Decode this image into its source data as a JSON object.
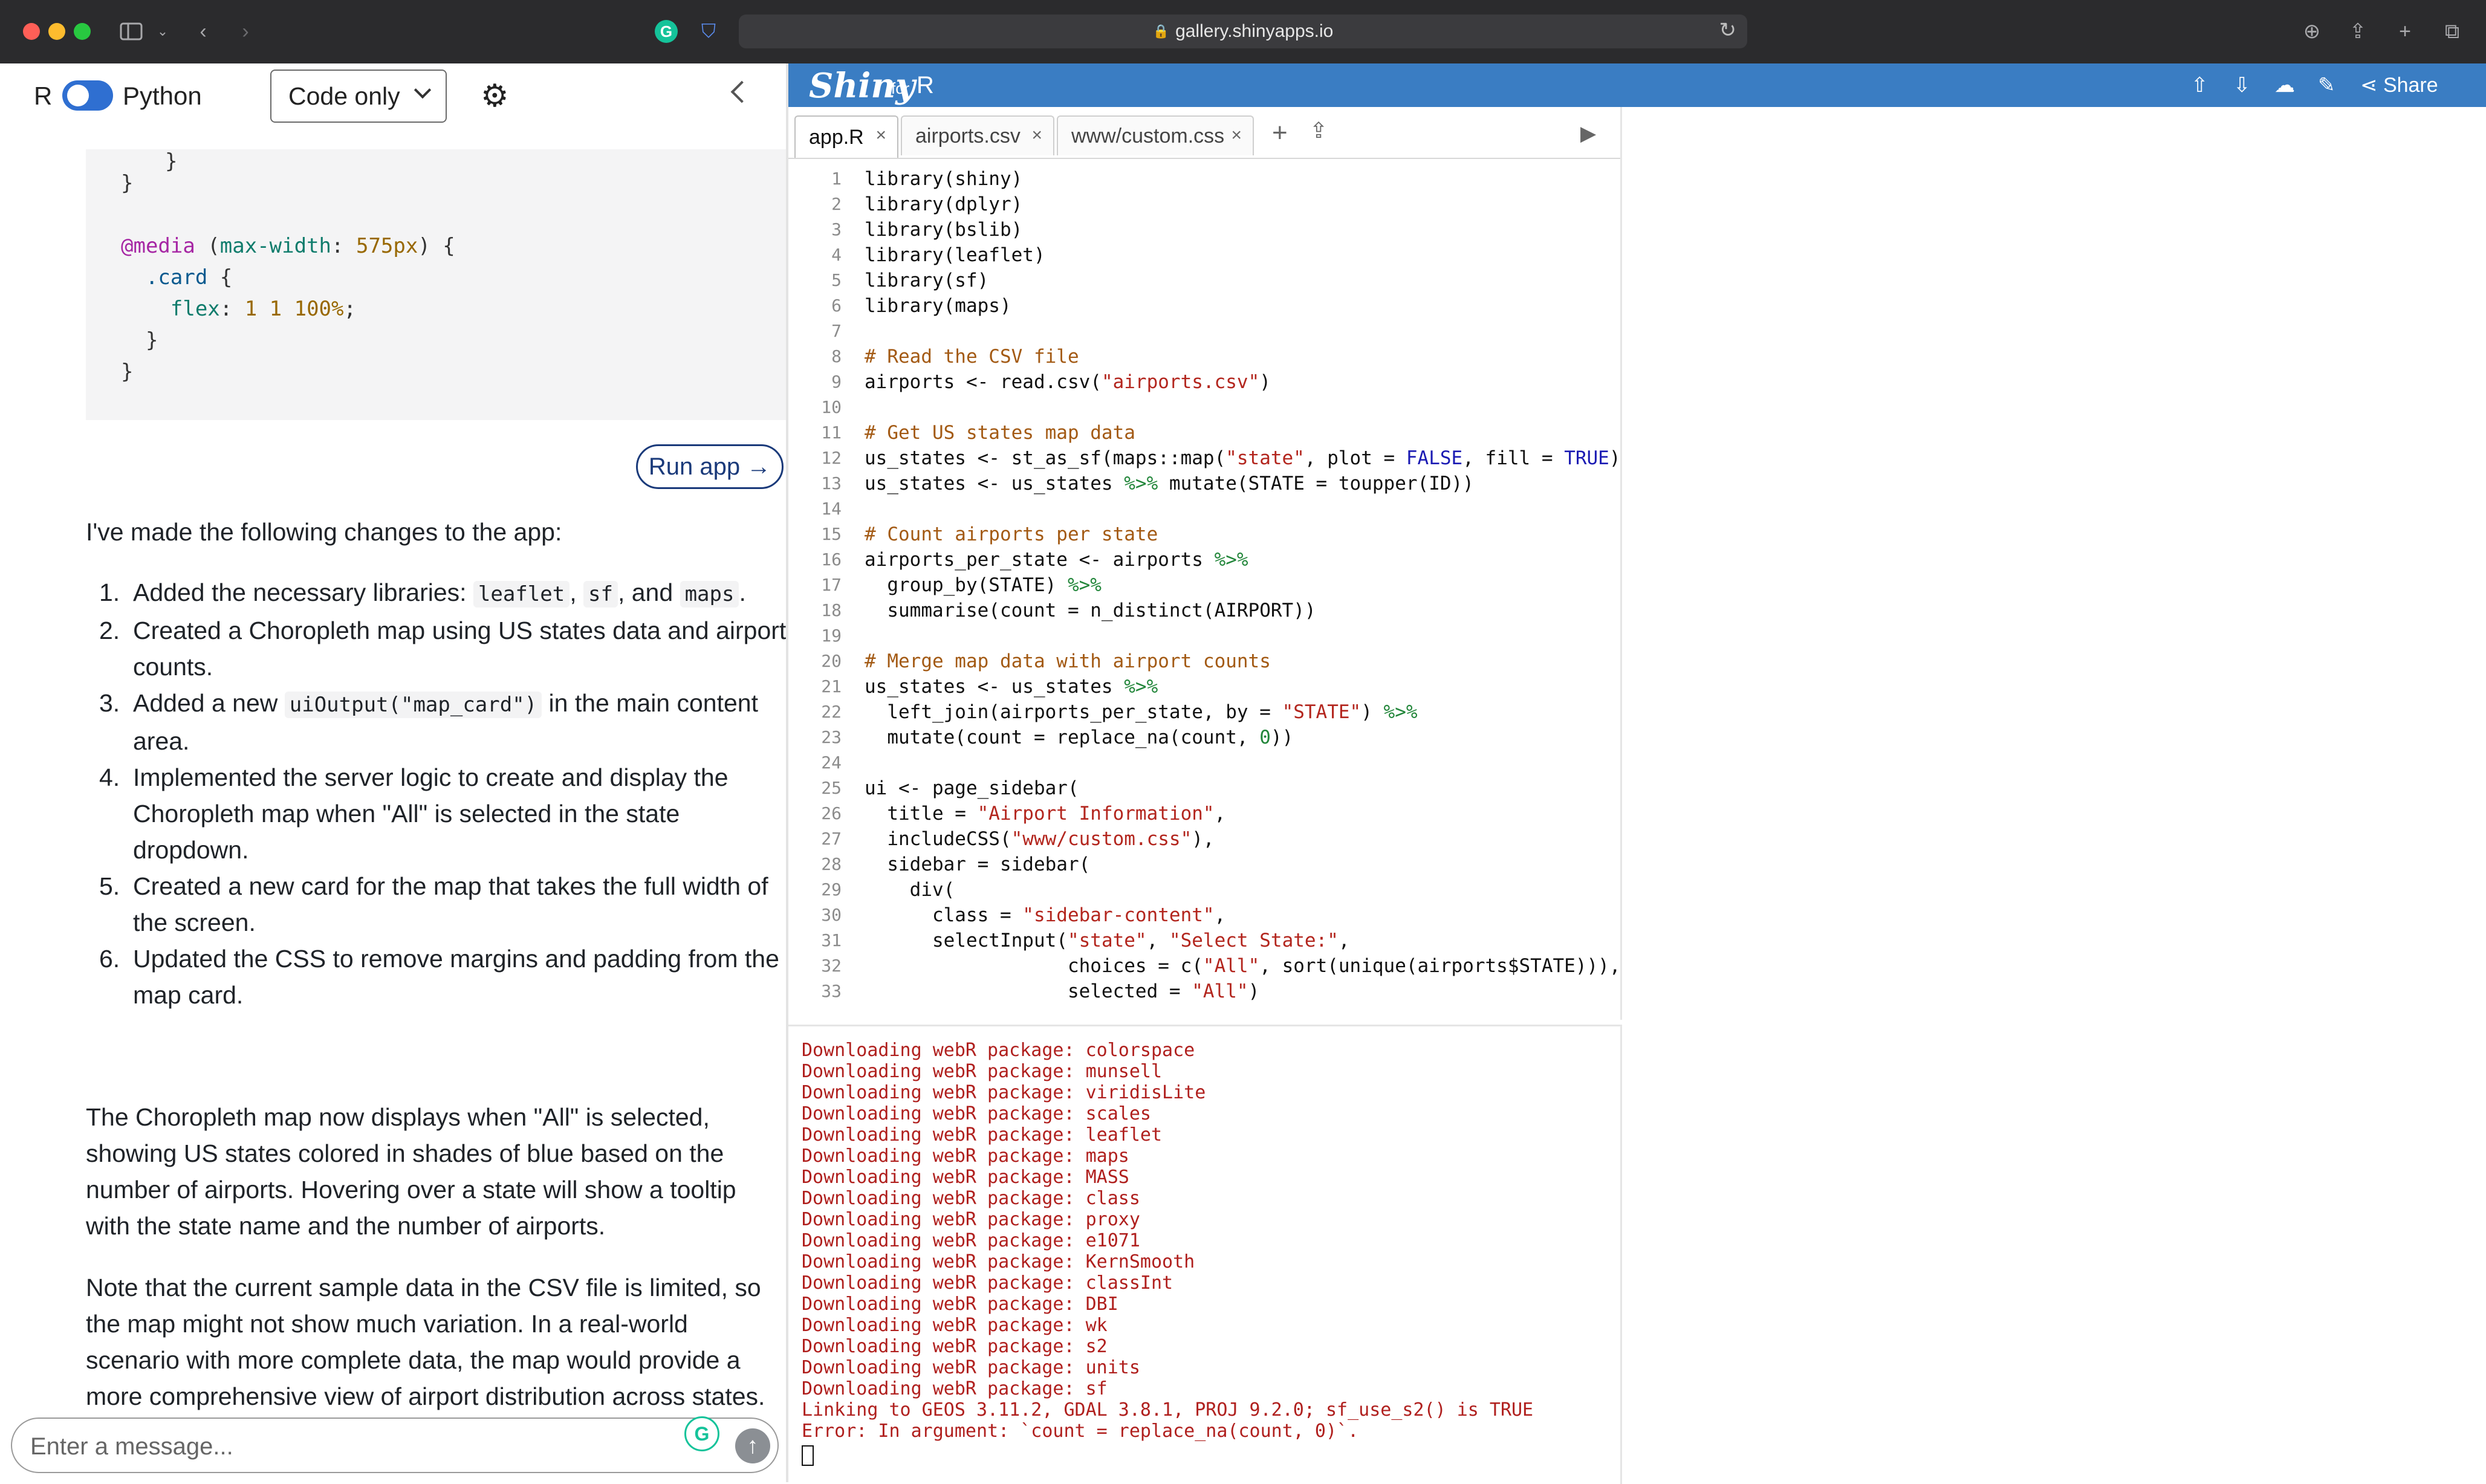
{
  "browser": {
    "url": "gallery.shinyapps.io"
  },
  "left": {
    "lang_r": "R",
    "lang_py": "Python",
    "view_select": "Code only",
    "code_lines": [
      "  }",
      "}",
      "",
      "@media (max-width: 575px) {",
      "  .card {",
      "    flex: 1 1 100%;",
      "  }",
      "}"
    ],
    "run_app": "Run app →",
    "intro": "I've made the following changes to the app:",
    "changes": [
      {
        "n": "1.",
        "before": "Added the necessary libraries: ",
        "code1": "leaflet",
        "mid1": ", ",
        "code2": "sf",
        "mid2": ", and ",
        "code3": "maps",
        "after": "."
      },
      {
        "n": "2.",
        "text": "Created a Choropleth map using US states data and airport counts."
      },
      {
        "n": "3.",
        "before": "Added a new ",
        "code1": "uiOutput(\"map_card\")",
        "after": " in the main content area."
      },
      {
        "n": "4.",
        "text": "Implemented the server logic to create and display the Choropleth map when \"All\" is selected in the state dropdown."
      },
      {
        "n": "5.",
        "text": "Created a new card for the map that takes the full width of the screen."
      },
      {
        "n": "6.",
        "text": "Updated the CSS to remove margins and padding from the map card."
      }
    ],
    "para2": "The Choropleth map now displays when \"All\" is selected, showing US states colored in shades of blue based on the number of airports. Hovering over a state will show a tooltip with the state name and the number of airports.",
    "para3": "Note that the current sample data in the CSV file is limited, so the map might not show much variation. In a real-world scenario with more complete data, the map would provide a more comprehensive view of airport distribution across states.",
    "message_placeholder": "Enter a message..."
  },
  "shiny": {
    "logo": "Shiny",
    "logo_for": "for",
    "logo_r": "R",
    "share": "Share",
    "tabs": [
      {
        "label": "app.R",
        "active": true
      },
      {
        "label": "airports.csv",
        "active": false
      },
      {
        "label": "www/custom.css",
        "active": false
      }
    ]
  },
  "editor_lines": [
    {
      "n": "1",
      "t": "library(shiny)"
    },
    {
      "n": "2",
      "t": "library(dplyr)"
    },
    {
      "n": "3",
      "t": "library(bslib)"
    },
    {
      "n": "4",
      "t": "library(leaflet)"
    },
    {
      "n": "5",
      "t": "library(sf)"
    },
    {
      "n": "6",
      "t": "library(maps)"
    },
    {
      "n": "7",
      "t": ""
    },
    {
      "n": "8",
      "t": "# Read the CSV file"
    },
    {
      "n": "9",
      "t": "airports <- read.csv(\"airports.csv\")"
    },
    {
      "n": "10",
      "t": ""
    },
    {
      "n": "11",
      "t": "# Get US states map data"
    },
    {
      "n": "12",
      "t": "us_states <- st_as_sf(maps::map(\"state\", plot = FALSE, fill = TRUE))"
    },
    {
      "n": "13",
      "t": "us_states <- us_states %>% mutate(STATE = toupper(ID))"
    },
    {
      "n": "14",
      "t": ""
    },
    {
      "n": "15",
      "t": "# Count airports per state"
    },
    {
      "n": "16",
      "t": "airports_per_state <- airports %>%"
    },
    {
      "n": "17",
      "t": "  group_by(STATE) %>%"
    },
    {
      "n": "18",
      "t": "  summarise(count = n_distinct(AIRPORT))"
    },
    {
      "n": "19",
      "t": ""
    },
    {
      "n": "20",
      "t": "# Merge map data with airport counts"
    },
    {
      "n": "21",
      "t": "us_states <- us_states %>%"
    },
    {
      "n": "22",
      "t": "  left_join(airports_per_state, by = \"STATE\") %>%"
    },
    {
      "n": "23",
      "t": "  mutate(count = replace_na(count, 0))"
    },
    {
      "n": "24",
      "t": ""
    },
    {
      "n": "25",
      "t": "ui <- page_sidebar("
    },
    {
      "n": "26",
      "t": "  title = \"Airport Information\","
    },
    {
      "n": "27",
      "t": "  includeCSS(\"www/custom.css\"),"
    },
    {
      "n": "28",
      "t": "  sidebar = sidebar("
    },
    {
      "n": "29",
      "t": "    div("
    },
    {
      "n": "30",
      "t": "      class = \"sidebar-content\","
    },
    {
      "n": "31",
      "t": "      selectInput(\"state\", \"Select State:\","
    },
    {
      "n": "32",
      "t": "                  choices = c(\"All\", sort(unique(airports$STATE))),"
    },
    {
      "n": "33",
      "t": "                  selected = \"All\")"
    }
  ],
  "console_lines": [
    "Downloading webR package: colorspace",
    "Downloading webR package: munsell",
    "Downloading webR package: viridisLite",
    "Downloading webR package: scales",
    "Downloading webR package: leaflet",
    "Downloading webR package: maps",
    "Downloading webR package: MASS",
    "Downloading webR package: class",
    "Downloading webR package: proxy",
    "Downloading webR package: e1071",
    "Downloading webR package: KernSmooth",
    "Downloading webR package: classInt",
    "Downloading webR package: DBI",
    "Downloading webR package: wk",
    "Downloading webR package: s2",
    "Downloading webR package: units",
    "Downloading webR package: sf",
    "Linking to GEOS 3.11.2, GDAL 3.8.1, PROJ 9.2.0; sf_use_s2() is TRUE",
    "Error: In argument: `count = replace_na(count, 0)`."
  ],
  "colors": {
    "shiny_blue": "#3a7dc3",
    "console_red": "#b0201e",
    "toggle_blue": "#2f6fd1"
  }
}
